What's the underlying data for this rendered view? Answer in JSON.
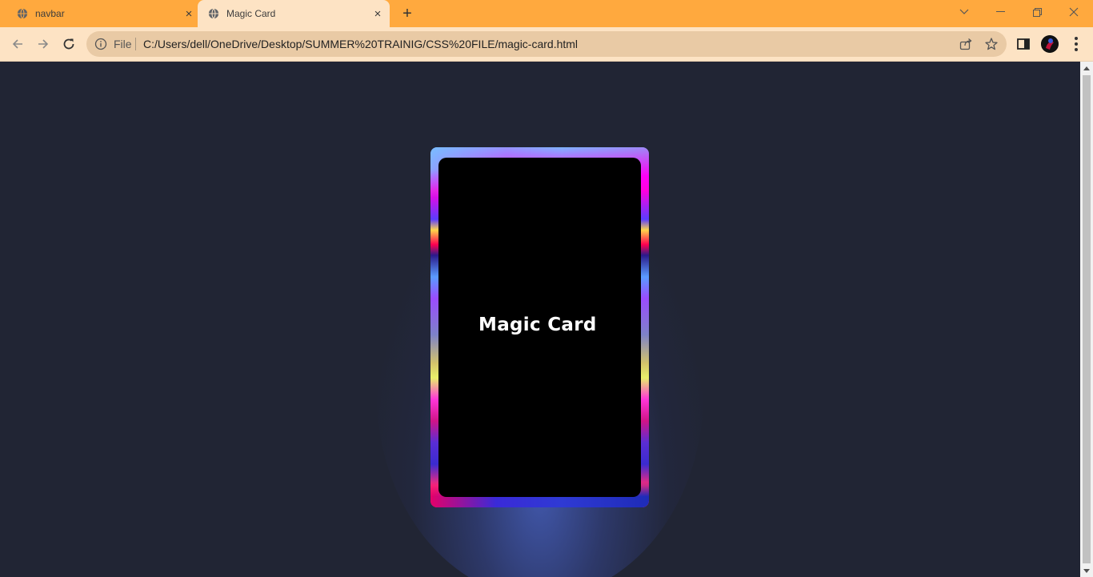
{
  "tabs": [
    {
      "title": "navbar",
      "close": "×",
      "active": false,
      "icon": "globe-icon"
    },
    {
      "title": "Magic Card",
      "close": "×",
      "active": true,
      "icon": "globe-icon"
    }
  ],
  "new_tab": "+",
  "address_bar": {
    "scheme_label": "File",
    "url": "C:/Users/dell/OneDrive/Desktop/SUMMER%20TRAINIG/CSS%20FILE/magic-card.html"
  },
  "page": {
    "card_title": "Magic Card"
  },
  "colors": {
    "tab_strip": "#ffa93e",
    "toolbar": "#fde3c4",
    "page_background": "#212534",
    "card_face": "#000000"
  }
}
